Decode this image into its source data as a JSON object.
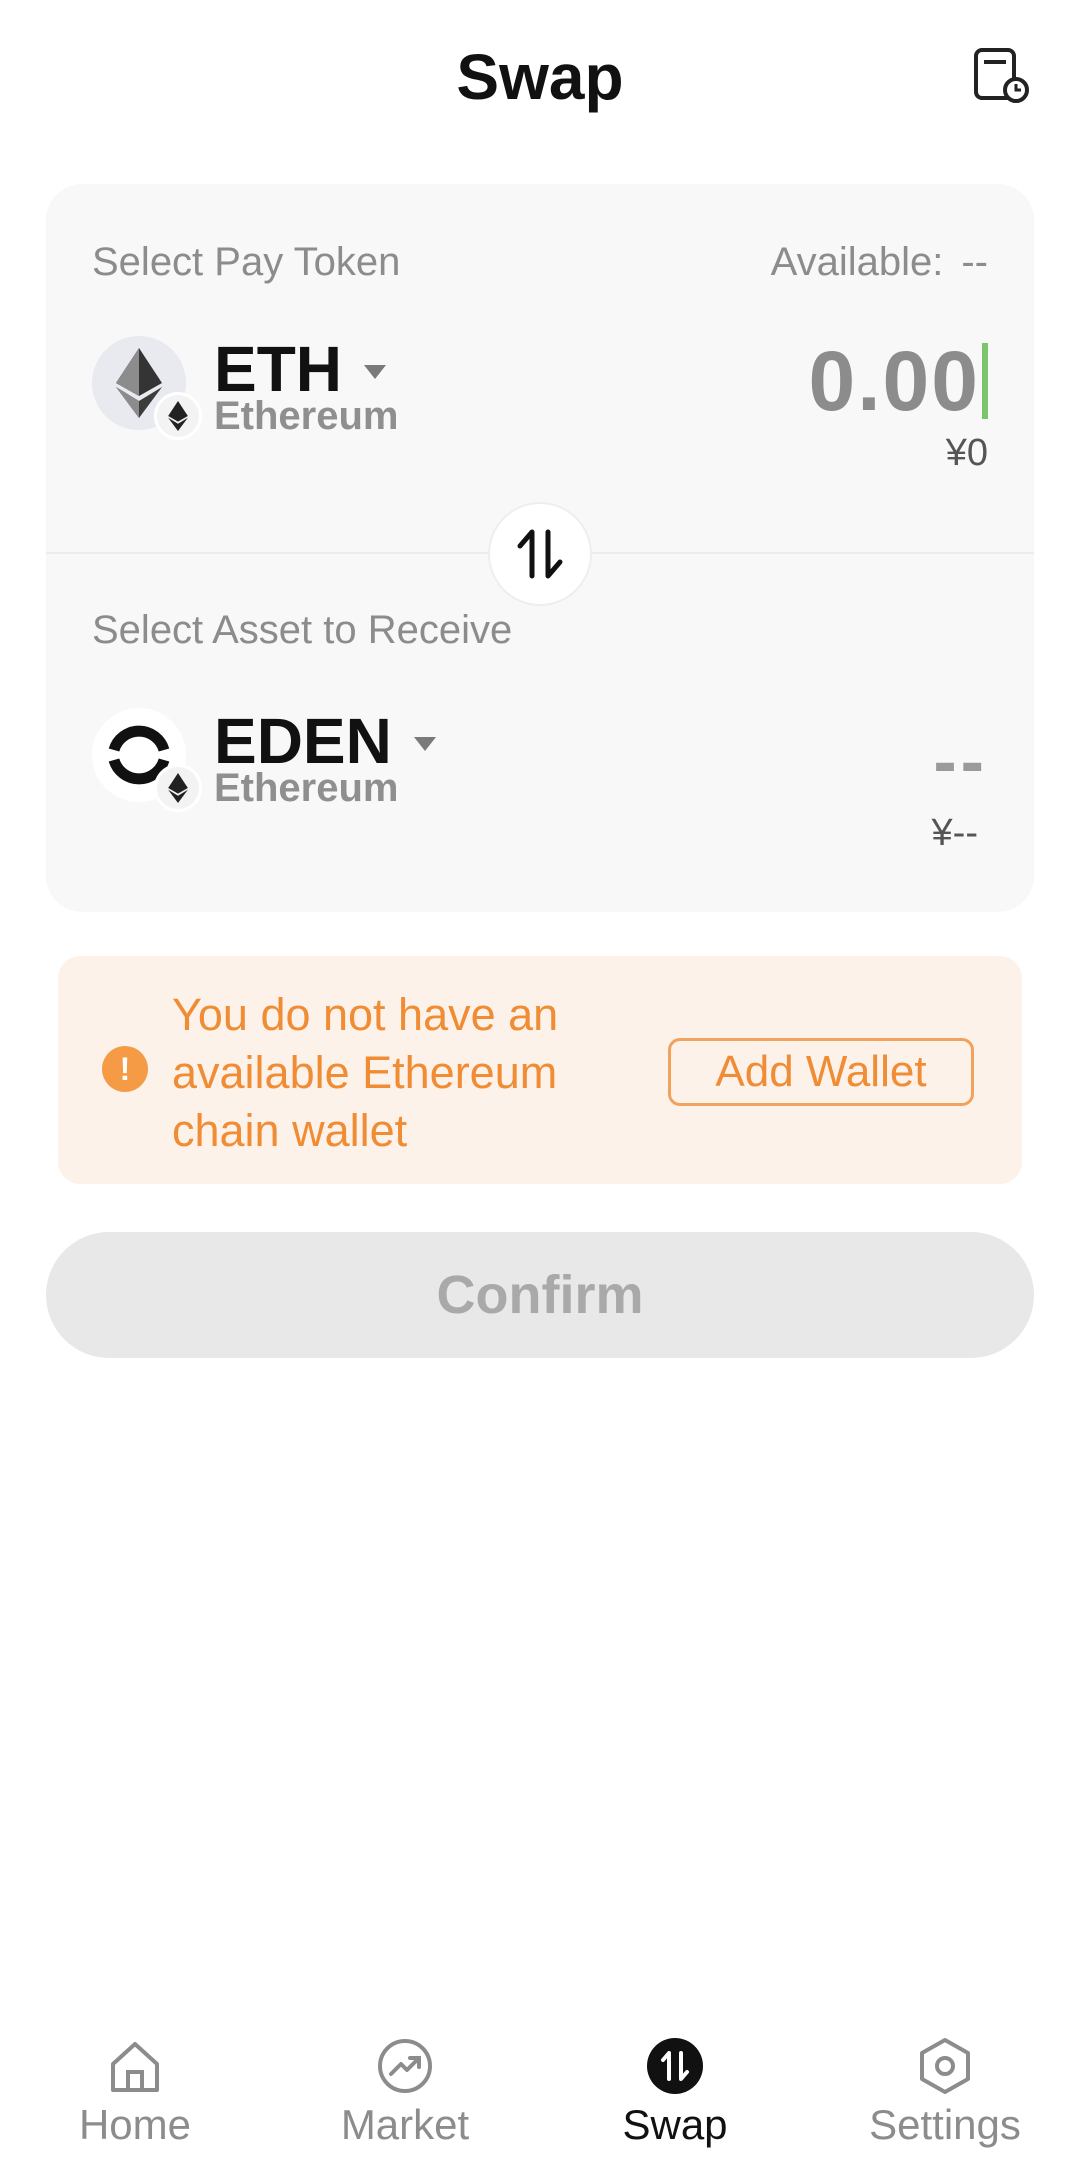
{
  "header": {
    "title": "Swap",
    "history_icon": "history-icon"
  },
  "pay": {
    "label": "Select Pay Token",
    "available_label": "Available:",
    "available_value": "--",
    "token_symbol": "ETH",
    "token_chain": "Ethereum",
    "amount": "0.00",
    "fiat": "¥0"
  },
  "receive": {
    "label": "Select Asset to Receive",
    "token_symbol": "EDEN",
    "token_chain": "Ethereum",
    "amount": "--",
    "fiat": "¥--"
  },
  "warning": {
    "text": "You do not have an available Ethereum chain wallet",
    "button": "Add Wallet",
    "color": "#f08c34"
  },
  "confirm_label": "Confirm",
  "nav": {
    "items": [
      {
        "label": "Home",
        "icon": "home-icon"
      },
      {
        "label": "Market",
        "icon": "market-icon"
      },
      {
        "label": "Swap",
        "icon": "swap-icon",
        "active": true
      },
      {
        "label": "Settings",
        "icon": "settings-icon"
      }
    ]
  }
}
